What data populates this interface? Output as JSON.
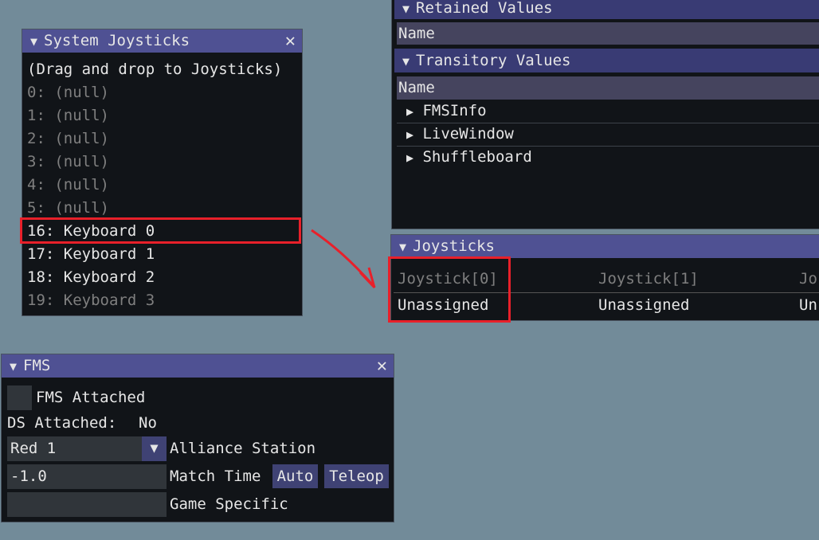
{
  "system_joysticks": {
    "title": "System Joysticks",
    "hint": "(Drag and drop to Joysticks)",
    "items": [
      {
        "label": "0: (null)",
        "active": false
      },
      {
        "label": "1: (null)",
        "active": false
      },
      {
        "label": "2: (null)",
        "active": false
      },
      {
        "label": "3: (null)",
        "active": false
      },
      {
        "label": "4: (null)",
        "active": false
      },
      {
        "label": "5: (null)",
        "active": false
      },
      {
        "label": "16: Keyboard 0",
        "active": true
      },
      {
        "label": "17: Keyboard 1",
        "active": true
      },
      {
        "label": "18: Keyboard 2",
        "active": true
      },
      {
        "label": "19: Keyboard 3",
        "active": false
      }
    ]
  },
  "network_tables": {
    "retained_header": "Retained Values",
    "retained_col": "Name",
    "transitory_header": "Transitory Values",
    "transitory_col": "Name",
    "items": [
      "FMSInfo",
      "LiveWindow",
      "Shuffleboard"
    ]
  },
  "joysticks": {
    "title": "Joysticks",
    "columns": [
      "Joystick[0]",
      "Joystick[1]",
      "Jo"
    ],
    "values": [
      "Unassigned",
      "Unassigned",
      "Un"
    ]
  },
  "fms": {
    "title": "FMS",
    "fms_attached_label": "FMS Attached",
    "fms_attached": false,
    "ds_attached_label": "DS Attached:",
    "ds_attached_value": "No",
    "alliance_value": "Red 1",
    "alliance_label": "Alliance Station",
    "match_time_value": "-1.0",
    "match_time_label": "Match Time",
    "auto_label": "Auto",
    "teleop_label": "Teleop",
    "game_specific_value": "",
    "game_specific_label": "Game Specific"
  },
  "colors": {
    "title_bar": "#4f5193",
    "highlight": "#e8202a",
    "background": "#728b99"
  }
}
